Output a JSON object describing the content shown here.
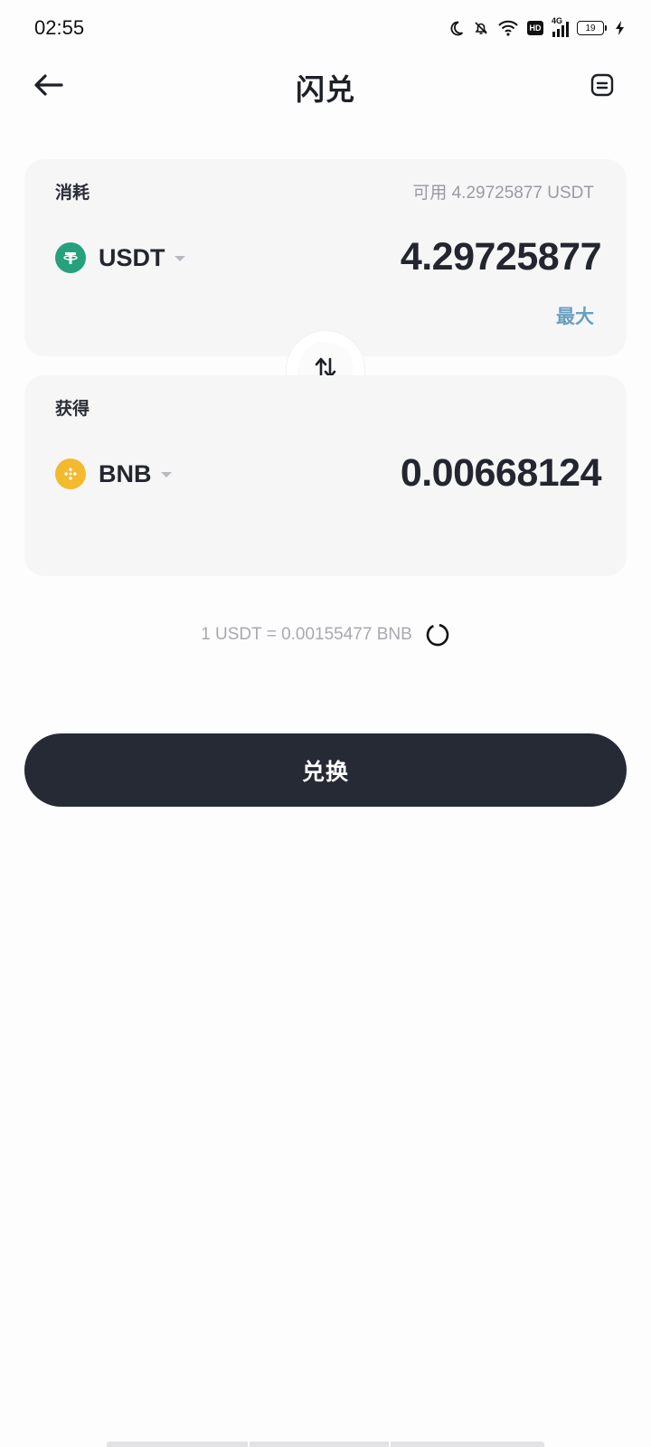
{
  "status_bar": {
    "time": "02:55",
    "network": "4G",
    "hd": "HD",
    "battery": "19",
    "icons": [
      "moon-icon",
      "bell-muted-icon",
      "wifi-icon",
      "hd-icon",
      "signal-4g-icon",
      "battery-icon",
      "charging-icon"
    ]
  },
  "header": {
    "title": "闪兑",
    "back_icon": "arrow-left-icon",
    "history_icon": "document-list-icon"
  },
  "pay_card": {
    "label": "消耗",
    "available": "可用 4.29725877 USDT",
    "token": "USDT",
    "amount": "4.29725877",
    "max_label": "最大"
  },
  "get_card": {
    "label": "获得",
    "token": "BNB",
    "amount": "0.00668124"
  },
  "rate": {
    "text": "1 USDT = 0.00155477 BNB"
  },
  "exchange_button": {
    "label": "兑换"
  },
  "colors": {
    "usdt": "#26a17b",
    "bnb": "#f3ba2f",
    "button_bg": "#262a35",
    "accent_max": "#6a9fc0",
    "card_bg": "#f6f6f7"
  }
}
